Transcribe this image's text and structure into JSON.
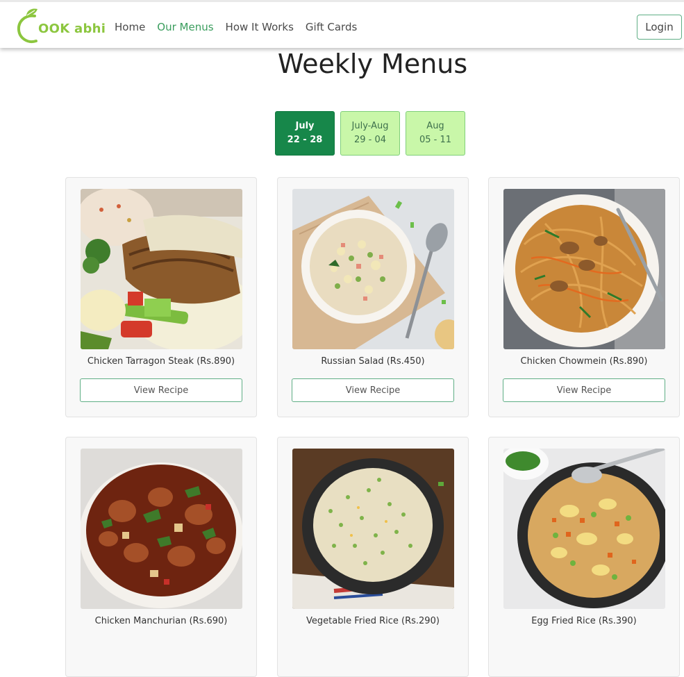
{
  "brand": {
    "logo_text": "OOK abhi",
    "accent_color": "#8cc63f"
  },
  "nav": {
    "links": [
      "Home",
      "Our Menus",
      "How It Works",
      "Gift Cards"
    ],
    "active": "Our Menus",
    "login_label": "Login"
  },
  "page": {
    "title": "Weekly Menus"
  },
  "weeks": [
    {
      "month": "July",
      "days": "22 - 28",
      "selected": true
    },
    {
      "month": "July-Aug",
      "days": "29 - 04",
      "selected": false
    },
    {
      "month": "Aug",
      "days": "05 - 11",
      "selected": false
    }
  ],
  "menu": {
    "button_label": "View Recipe",
    "items": [
      {
        "title": "Chicken Tarragon Steak (Rs.890)",
        "image": "chicken-tarragon-steak-photo"
      },
      {
        "title": "Russian Salad (Rs.450)",
        "image": "russian-salad-photo"
      },
      {
        "title": "Chicken Chowmein (Rs.890)",
        "image": "chicken-chowmein-photo"
      },
      {
        "title": "Chicken Manchurian (Rs.690)",
        "image": "chicken-manchurian-photo"
      },
      {
        "title": "Vegetable Fried Rice (Rs.290)",
        "image": "vegetable-fried-rice-photo"
      },
      {
        "title": "Egg Fried Rice (Rs.390)",
        "image": "egg-fried-rice-photo"
      }
    ]
  },
  "colors": {
    "primary_green": "#17874a",
    "light_green": "#c9f7a9",
    "active_link": "#3a9d5d",
    "button_border": "#5fae85"
  }
}
